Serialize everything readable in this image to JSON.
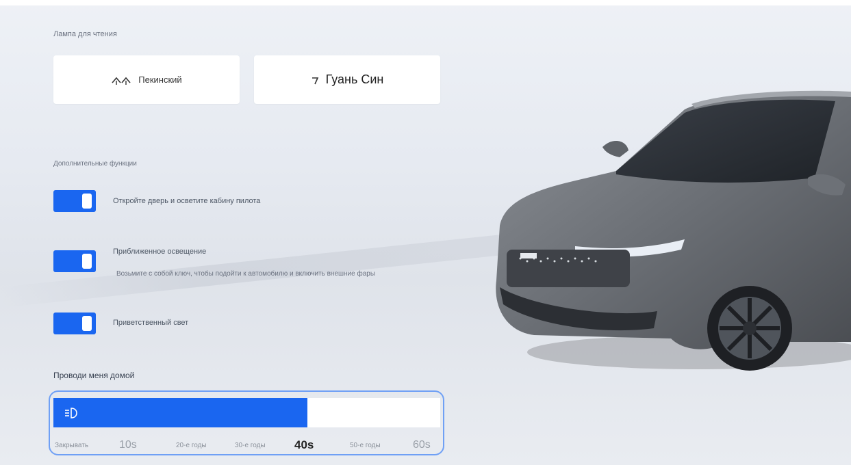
{
  "reading_lamp": {
    "section_title": "Лампа для чтения",
    "buttons": [
      {
        "label": "Пекинский"
      },
      {
        "label": "Гуань Син"
      }
    ]
  },
  "additional": {
    "section_title": "Дополнительные функции",
    "options": [
      {
        "label": "Откройте дверь и осветите кабину пилота",
        "enabled": true
      },
      {
        "label": "Приближенное освещение",
        "sub": "Возьмите с собой ключ, чтобы подойти к автомобилю и включить внешние фары",
        "enabled": true
      },
      {
        "label": "Приветственный свет",
        "enabled": true
      }
    ]
  },
  "follow_me_home": {
    "title": "Проводи меня домой",
    "value_fraction": 0.656,
    "ticks": [
      "Закрывать",
      "10s",
      "20-е годы",
      "30-е годы",
      "40s",
      "50-е годы",
      "60s"
    ],
    "selected": "40s"
  },
  "colors": {
    "accent": "#1a66f0",
    "frame": "#6fa0f5"
  }
}
